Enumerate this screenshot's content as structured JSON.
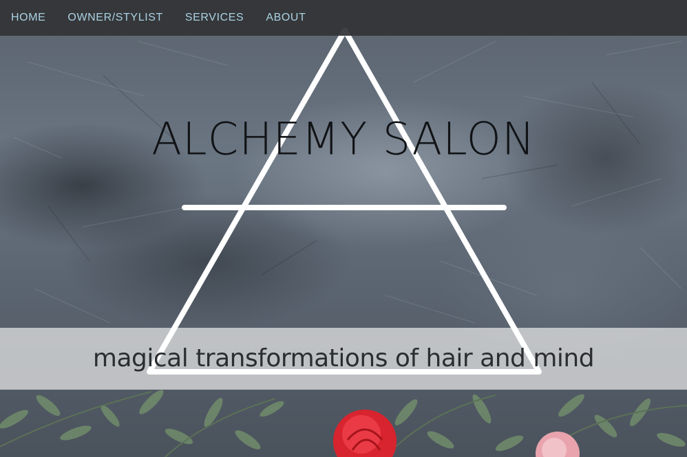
{
  "nav": {
    "items": [
      {
        "label": "HOME"
      },
      {
        "label": "OWNER/STYLIST"
      },
      {
        "label": "SERVICES"
      },
      {
        "label": "ABOUT"
      }
    ]
  },
  "hero": {
    "title": "ALCHEMY SALON",
    "tagline": "magical transformations of hair and mind",
    "logo_icon": "alchemy-triangle-air-symbol"
  },
  "colors": {
    "nav_bg": "#343436",
    "nav_text": "#a9d3e4",
    "title_text": "#111316",
    "tagline_band": "#e4e4e4",
    "logo_stroke": "#ffffff"
  }
}
